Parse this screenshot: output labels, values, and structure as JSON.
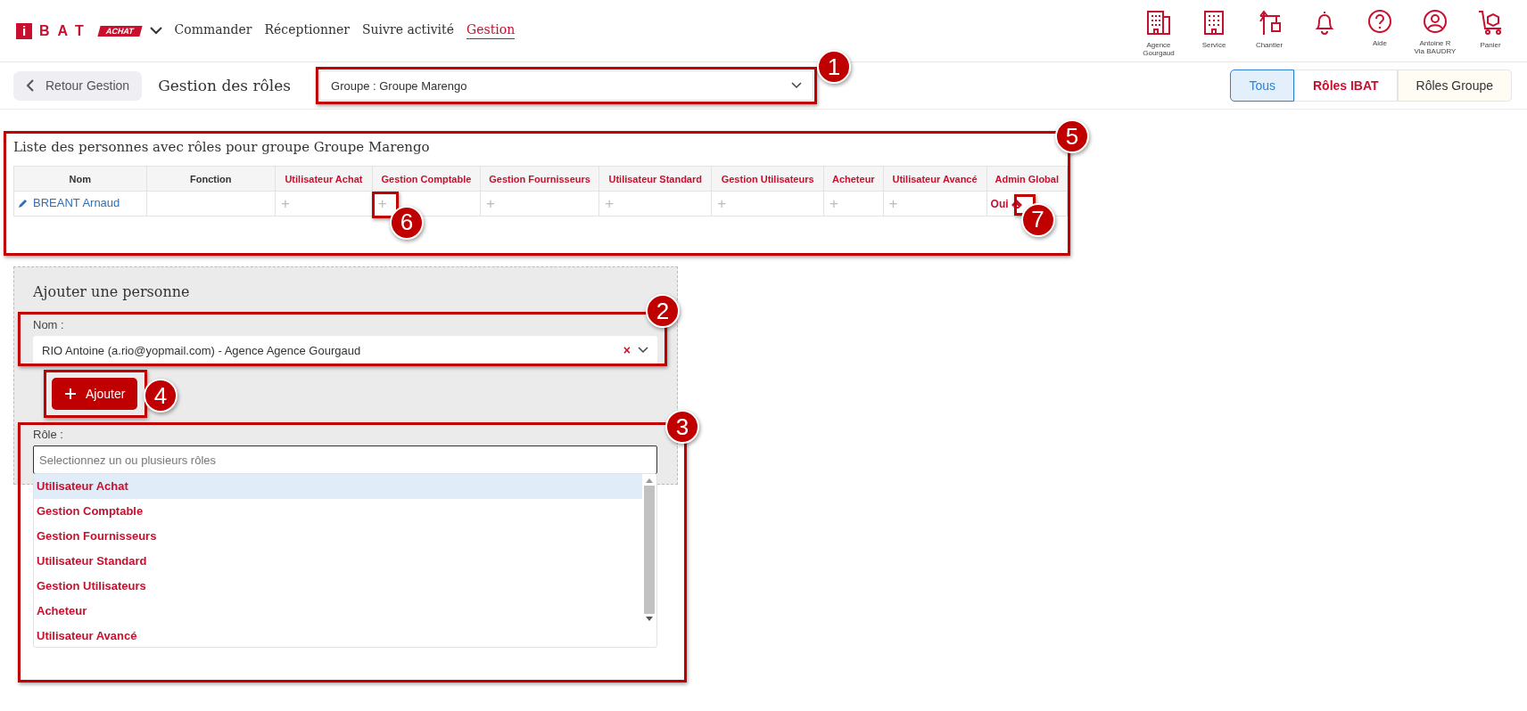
{
  "header": {
    "logo": {
      "mark": "i",
      "letters": "BAT",
      "badge": "ACHAT"
    },
    "nav": [
      {
        "label": "Commander",
        "selected": false
      },
      {
        "label": "Réceptionner",
        "selected": false
      },
      {
        "label": "Suivre activité",
        "selected": false
      },
      {
        "label": "Gestion",
        "selected": true
      }
    ],
    "shortcuts": [
      {
        "kind": "agency",
        "label": "Agence Gourgaud"
      },
      {
        "kind": "service",
        "label": "Service"
      },
      {
        "kind": "site",
        "label": "Chantier"
      },
      {
        "kind": "notifications"
      },
      {
        "kind": "help",
        "label": "Aide"
      },
      {
        "kind": "account",
        "label": "Antoine R",
        "sublabel": "Via BAUDRY"
      },
      {
        "kind": "cart",
        "label": "Panier"
      }
    ]
  },
  "toolbar": {
    "back": "Retour Gestion",
    "title": "Gestion des rôles",
    "group_select": {
      "value": "Groupe : Groupe Marengo",
      "callout": "1"
    },
    "tabs": [
      {
        "label": "Tous",
        "kind": "all",
        "selected": true
      },
      {
        "label": "Rôles IBAT",
        "kind": "ibat",
        "selected": false
      },
      {
        "label": "Rôles Groupe",
        "kind": "group",
        "selected": false
      }
    ]
  },
  "people": {
    "callout": "5",
    "title": "Liste des personnes avec rôles pour groupe Groupe Marengo",
    "columns": [
      {
        "label": "Nom",
        "kind": "info"
      },
      {
        "label": "Fonction",
        "kind": "info"
      },
      {
        "label": "Utilisateur Achat",
        "kind": "role"
      },
      {
        "label": "Gestion Comptable",
        "kind": "role"
      },
      {
        "label": "Gestion Fournisseurs",
        "kind": "role"
      },
      {
        "label": "Utilisateur Standard",
        "kind": "role"
      },
      {
        "label": "Gestion Utilisateurs",
        "kind": "role"
      },
      {
        "label": "Acheteur",
        "kind": "role"
      },
      {
        "label": "Utilisateur Avancé",
        "kind": "role"
      },
      {
        "label": "Admin Global",
        "kind": "role"
      }
    ],
    "rows": [
      {
        "cells": [
          {
            "kind": "person",
            "text": "BREANT Arnaud"
          },
          {
            "kind": "empty",
            "text": ""
          },
          {
            "kind": "add",
            "text": "+"
          },
          {
            "kind": "add",
            "text": "+",
            "callout": "6"
          },
          {
            "kind": "add",
            "text": "+"
          },
          {
            "kind": "add",
            "text": "+"
          },
          {
            "kind": "add",
            "text": "+"
          },
          {
            "kind": "add",
            "text": "+"
          },
          {
            "kind": "add",
            "text": "+"
          },
          {
            "kind": "yes",
            "text": "Oui",
            "callout": "7"
          }
        ]
      }
    ]
  },
  "add_person": {
    "title": "Ajouter une personne",
    "name_label": "Nom :",
    "name_value": "RIO Antoine (a.rio@yopmail.com) - Agence Agence Gourgaud",
    "name_clear": "×",
    "name_callout": "2",
    "button": "Ajouter",
    "button_callout": "4",
    "role_label": "Rôle :",
    "role_placeholder": "Selectionnez un ou plusieurs rôles",
    "role_callout": "3",
    "role_options": [
      {
        "label": "Utilisateur Achat",
        "selected": true
      },
      {
        "label": "Gestion Comptable",
        "selected": false
      },
      {
        "label": "Gestion Fournisseurs",
        "selected": false
      },
      {
        "label": "Utilisateur Standard",
        "selected": false
      },
      {
        "label": "Gestion Utilisateurs",
        "selected": false
      },
      {
        "label": "Acheteur",
        "selected": false
      },
      {
        "label": "Utilisateur Avancé",
        "selected": false
      }
    ]
  }
}
